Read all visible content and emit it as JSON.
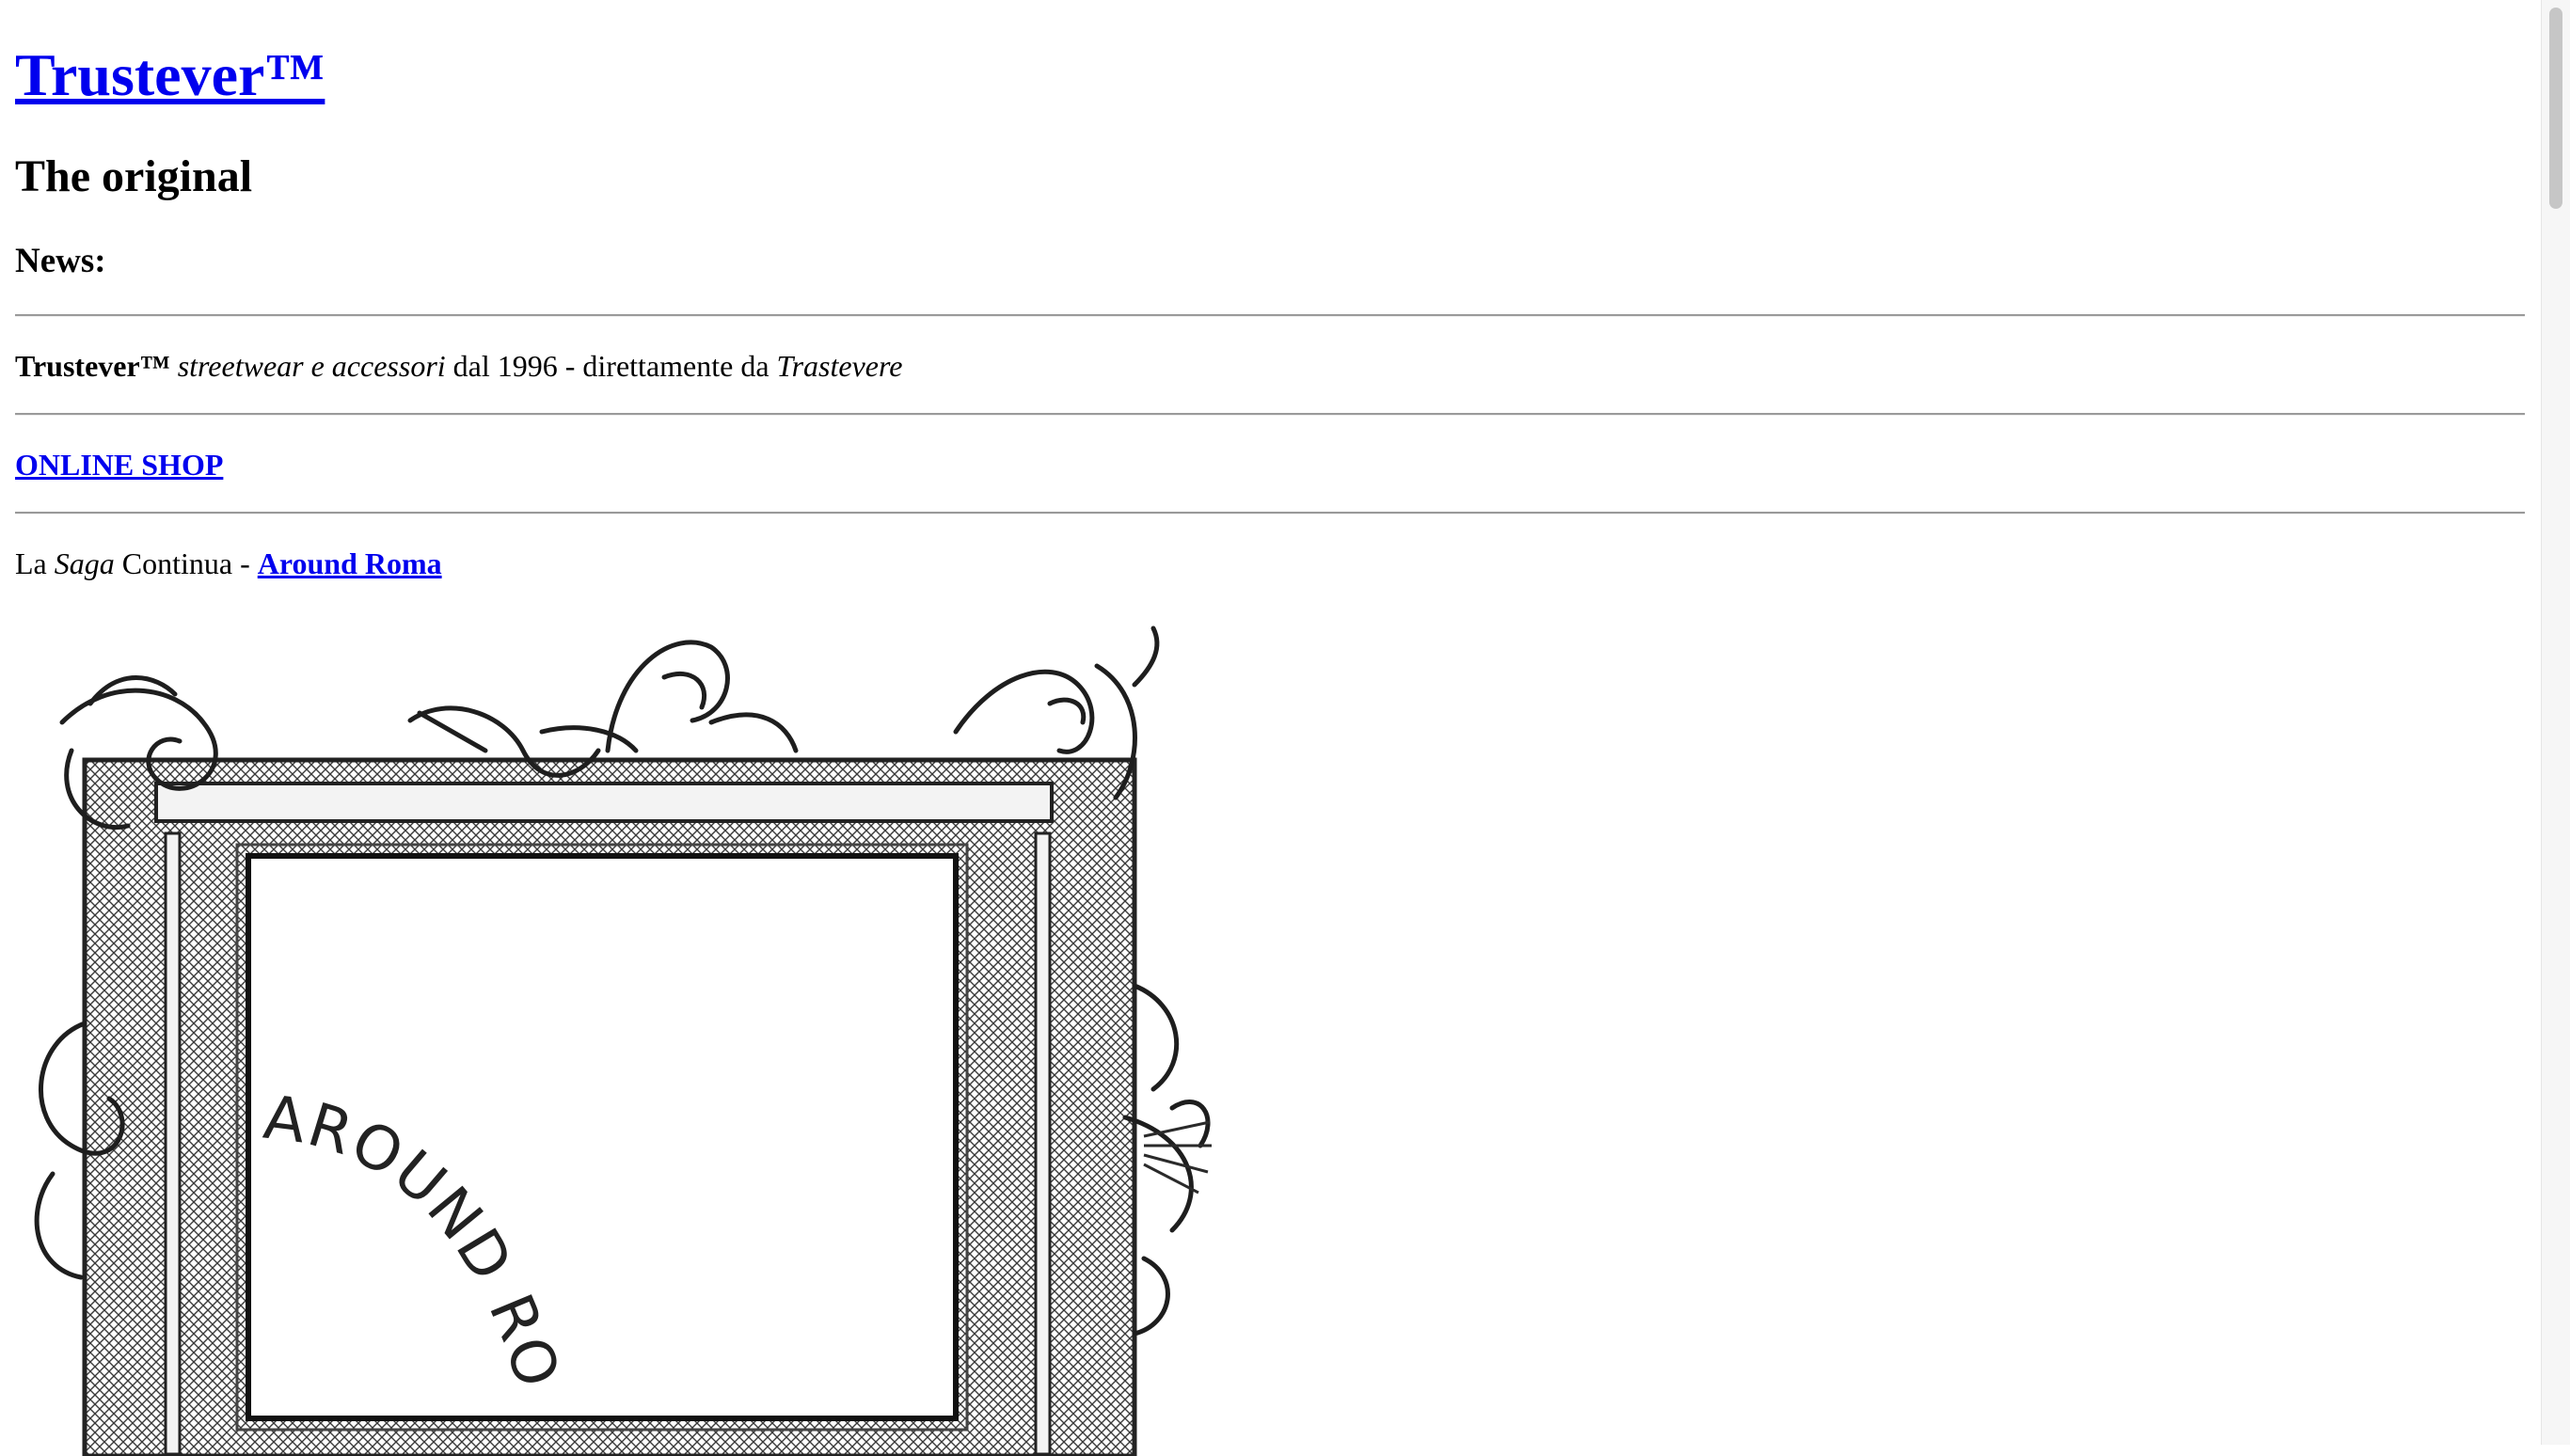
{
  "header": {
    "title": "Trustever™",
    "subtitle": "The original",
    "news_label": "News:"
  },
  "tagline": {
    "brand": "Trustever™",
    "products": "streetwear e accessori",
    "since": " dal 1996 - direttamente da ",
    "place": "Trastevere"
  },
  "shop": {
    "label": "ONLINE SHOP"
  },
  "saga": {
    "prefix": "La ",
    "word": "Saga",
    "middle": " Continua - ",
    "link": "Around Roma"
  },
  "image": {
    "caption_text": "AROUND ROMA",
    "line_color": "#2a2a2a"
  }
}
